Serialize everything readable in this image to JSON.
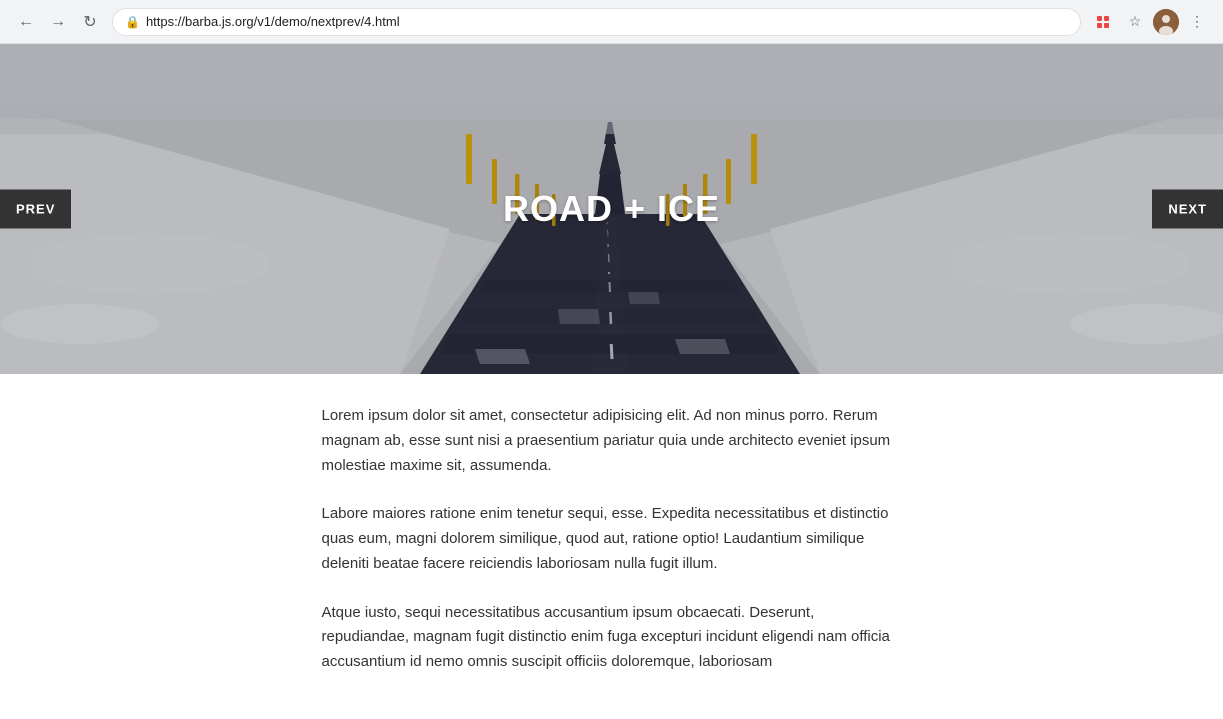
{
  "browser": {
    "url": "https://barba.js.org/v1/demo/nextprev/4.html",
    "back_disabled": false,
    "forward_disabled": false
  },
  "hero": {
    "title": "ROAD + ICE",
    "prev_label": "PREV",
    "next_label": "NEXT"
  },
  "content": {
    "paragraphs": [
      "Lorem ipsum dolor sit amet, consectetur adipisicing elit. Ad non minus porro. Rerum magnam ab, esse sunt nisi a praesentium pariatur quia unde architecto eveniet ipsum molestiae maxime sit, assumenda.",
      "Labore maiores ratione enim tenetur sequi, esse. Expedita necessitatibus et distinctio quas eum, magni dolorem similique, quod aut, ratione optio! Laudantium similique deleniti beatae facere reiciendis laboriosam nulla fugit illum.",
      "Atque iusto, sequi necessitatibus accusantium ipsum obcaecati. Deserunt, repudiandae, magnam fugit distinctio enim fuga excepturi incidunt eligendi nam officia accusantium id nemo omnis suscipit officiis doloremque, laboriosam"
    ]
  }
}
